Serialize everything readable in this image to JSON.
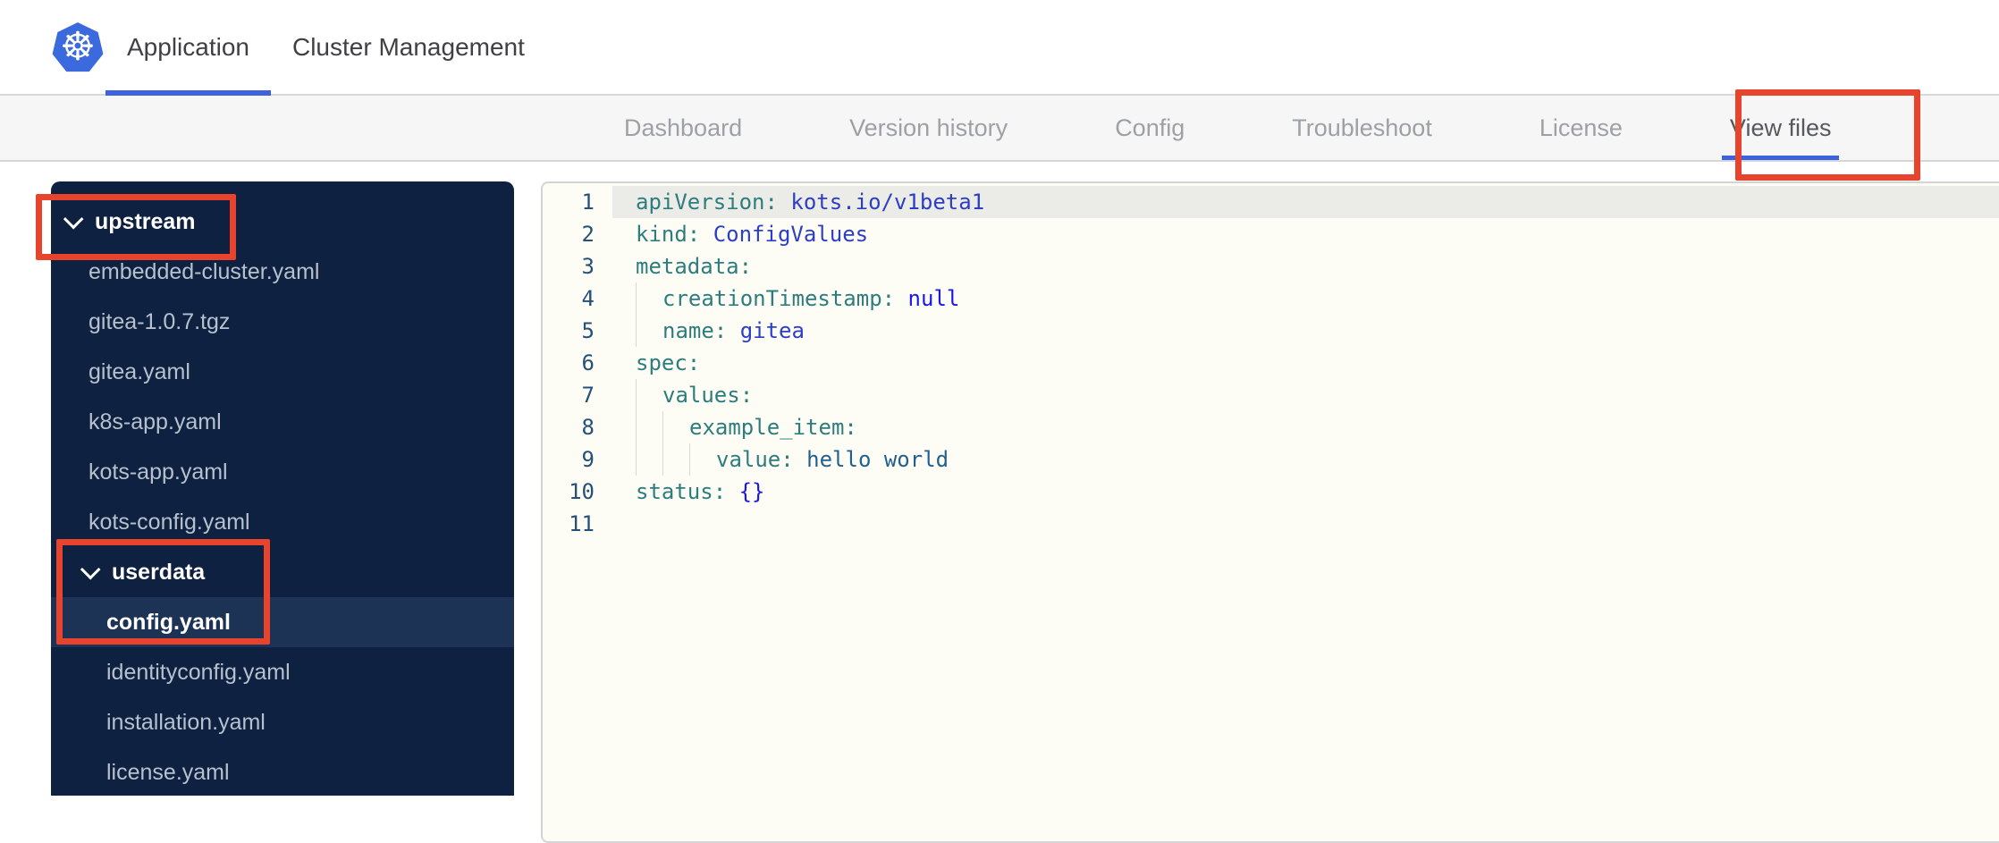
{
  "header": {
    "logo": "kubernetes-logo",
    "tabs": [
      {
        "label": "Application",
        "active": true
      },
      {
        "label": "Cluster Management",
        "active": false
      }
    ]
  },
  "subnav": {
    "tabs": [
      {
        "label": "Dashboard",
        "active": false
      },
      {
        "label": "Version history",
        "active": false
      },
      {
        "label": "Config",
        "active": false
      },
      {
        "label": "Troubleshoot",
        "active": false
      },
      {
        "label": "License",
        "active": false
      },
      {
        "label": "View files",
        "active": true
      }
    ]
  },
  "file_tree": {
    "items": [
      {
        "type": "folder",
        "label": "upstream",
        "level": 0,
        "expanded": true,
        "selected": false
      },
      {
        "type": "file",
        "label": "embedded-cluster.yaml",
        "level": 0,
        "selected": false
      },
      {
        "type": "file",
        "label": "gitea-1.0.7.tgz",
        "level": 0,
        "selected": false
      },
      {
        "type": "file",
        "label": "gitea.yaml",
        "level": 0,
        "selected": false
      },
      {
        "type": "file",
        "label": "k8s-app.yaml",
        "level": 0,
        "selected": false
      },
      {
        "type": "file",
        "label": "kots-app.yaml",
        "level": 0,
        "selected": false
      },
      {
        "type": "file",
        "label": "kots-config.yaml",
        "level": 0,
        "selected": false
      },
      {
        "type": "folder",
        "label": "userdata",
        "level": 1,
        "expanded": true,
        "selected": false
      },
      {
        "type": "file",
        "label": "config.yaml",
        "level": 1,
        "selected": true
      },
      {
        "type": "file",
        "label": "identityconfig.yaml",
        "level": 1,
        "selected": false
      },
      {
        "type": "file",
        "label": "installation.yaml",
        "level": 1,
        "selected": false
      },
      {
        "type": "file",
        "label": "license.yaml",
        "level": 1,
        "selected": false
      }
    ]
  },
  "editor": {
    "language": "yaml",
    "lines": [
      {
        "n": "1",
        "indent": 0,
        "highlight": true,
        "tokens": [
          [
            "k",
            "apiVersion:"
          ],
          [
            "v",
            " kots.io/v1beta1"
          ]
        ]
      },
      {
        "n": "2",
        "indent": 0,
        "highlight": false,
        "tokens": [
          [
            "k",
            "kind:"
          ],
          [
            "v",
            " ConfigValues"
          ]
        ]
      },
      {
        "n": "3",
        "indent": 0,
        "highlight": false,
        "tokens": [
          [
            "k",
            "metadata:"
          ]
        ]
      },
      {
        "n": "4",
        "indent": 1,
        "highlight": false,
        "tokens": [
          [
            "k",
            "creationTimestamp:"
          ],
          [
            "n",
            " null"
          ]
        ]
      },
      {
        "n": "5",
        "indent": 1,
        "highlight": false,
        "tokens": [
          [
            "k",
            "name:"
          ],
          [
            "v",
            " gitea"
          ]
        ]
      },
      {
        "n": "6",
        "indent": 0,
        "highlight": false,
        "tokens": [
          [
            "k",
            "spec:"
          ]
        ]
      },
      {
        "n": "7",
        "indent": 1,
        "highlight": false,
        "tokens": [
          [
            "k",
            "values:"
          ]
        ]
      },
      {
        "n": "8",
        "indent": 2,
        "highlight": false,
        "tokens": [
          [
            "k",
            "example_item:"
          ]
        ]
      },
      {
        "n": "9",
        "indent": 3,
        "highlight": false,
        "tokens": [
          [
            "k",
            "value:"
          ],
          [
            "s",
            " hello world"
          ]
        ]
      },
      {
        "n": "10",
        "indent": 0,
        "highlight": false,
        "tokens": [
          [
            "k",
            "status:"
          ],
          [
            "n",
            " {}"
          ]
        ]
      },
      {
        "n": "11",
        "indent": 0,
        "highlight": false,
        "tokens": []
      }
    ]
  },
  "annotations": {
    "color": "#e8432c",
    "boxes": [
      "view-files-tab",
      "upstream-folder",
      "userdata-config-yaml"
    ]
  },
  "colors": {
    "k8s_blue": "#3a6ade",
    "active_tab_underline": "#3c63dd",
    "sidebar_bg": "#0e2140",
    "sidebar_selected_bg": "#1d3355",
    "yaml_key": "#2e7d7d",
    "yaml_value": "#2c3ec5",
    "yaml_null": "#1a17e8",
    "annotation_red": "#e8432c"
  }
}
